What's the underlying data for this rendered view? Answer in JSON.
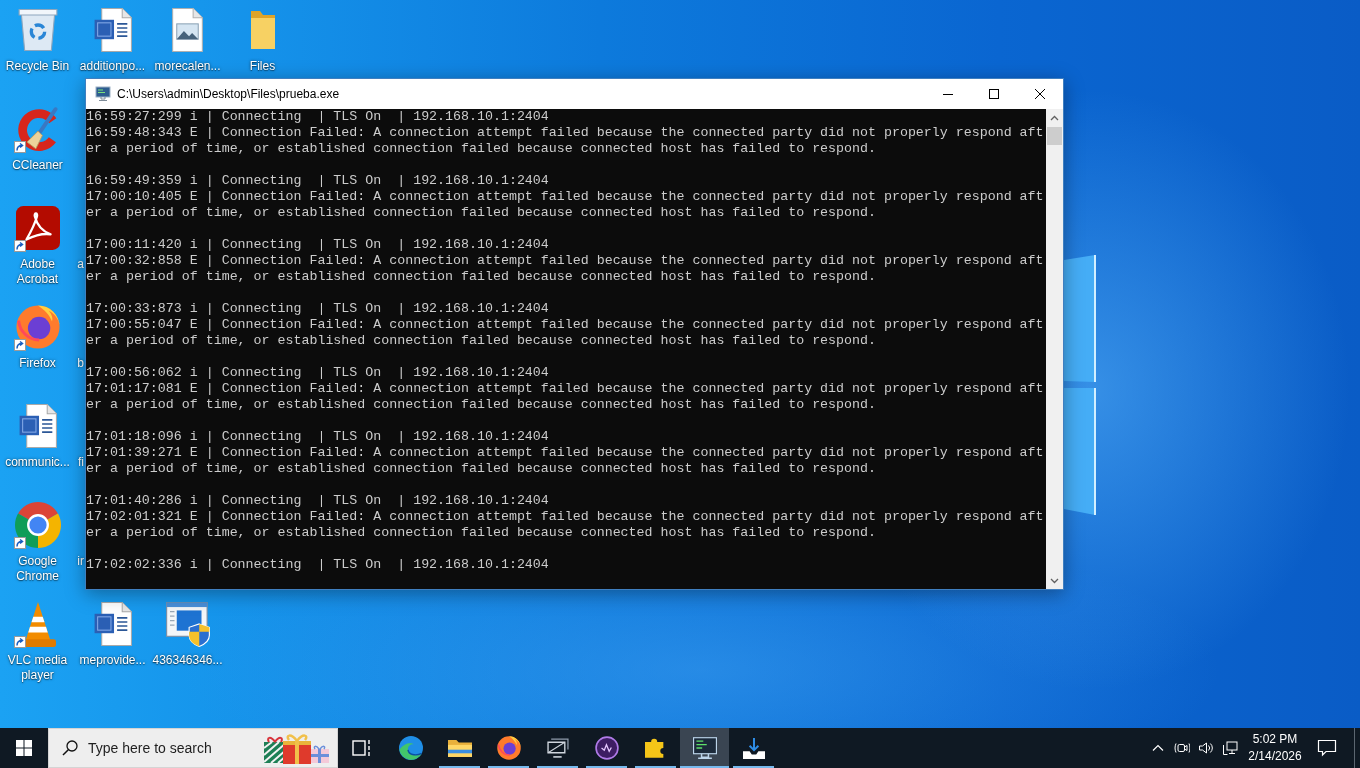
{
  "desktop": {
    "top_row": [
      {
        "label": "Recycle Bin",
        "kind": "bin",
        "shortcut": false
      },
      {
        "label": "additionpo...",
        "kind": "document",
        "shortcut": false
      },
      {
        "label": "morecalen...",
        "kind": "image",
        "shortcut": false
      },
      {
        "label": "Files",
        "kind": "folder",
        "shortcut": false
      }
    ],
    "left_column": [
      {
        "label": "CCleaner",
        "kind": "cleaner",
        "shortcut": true
      },
      {
        "label": "Adobe Acrobat",
        "kind": "pdf",
        "shortcut": true
      },
      {
        "label": "Firefox",
        "kind": "firefox",
        "shortcut": true
      },
      {
        "label": "communic...",
        "kind": "document",
        "shortcut": false
      },
      {
        "label": "Google Chrome",
        "kind": "chrome",
        "shortcut": true
      }
    ],
    "covered_labels": [
      "a",
      "b",
      "fi",
      "ir"
    ],
    "bottom_row": [
      {
        "label": "VLC media player",
        "kind": "vlc",
        "shortcut": true
      },
      {
        "label": "meprovide...",
        "kind": "document",
        "shortcut": false
      },
      {
        "label": "436346346...",
        "kind": "setup",
        "shortcut": false
      }
    ]
  },
  "window": {
    "title": "C:\\Users\\admin\\Desktop\\Files\\prueba.exe",
    "log": [
      {
        "info": "16:59:27:299 i | Connecting  | TLS On  | 192.168.10.1:2404",
        "error": "16:59:48:343 E | Connection Failed: A connection attempt failed because the connected party did not properly respond after a period of time, or established connection failed because connected host has failed to respond."
      },
      {
        "info": "16:59:49:359 i | Connecting  | TLS On  | 192.168.10.1:2404",
        "error": "17:00:10:405 E | Connection Failed: A connection attempt failed because the connected party did not properly respond after a period of time, or established connection failed because connected host has failed to respond."
      },
      {
        "info": "17:00:11:420 i | Connecting  | TLS On  | 192.168.10.1:2404",
        "error": "17:00:32:858 E | Connection Failed: A connection attempt failed because the connected party did not properly respond after a period of time, or established connection failed because connected host has failed to respond."
      },
      {
        "info": "17:00:33:873 i | Connecting  | TLS On  | 192.168.10.1:2404",
        "error": "17:00:55:047 E | Connection Failed: A connection attempt failed because the connected party did not properly respond after a period of time, or established connection failed because connected host has failed to respond."
      },
      {
        "info": "17:00:56:062 i | Connecting  | TLS On  | 192.168.10.1:2404",
        "error": "17:01:17:081 E | Connection Failed: A connection attempt failed because the connected party did not properly respond after a period of time, or established connection failed because connected host has failed to respond."
      },
      {
        "info": "17:01:18:096 i | Connecting  | TLS On  | 192.168.10.1:2404",
        "error": "17:01:39:271 E | Connection Failed: A connection attempt failed because the connected party did not properly respond after a period of time, or established connection failed because connected host has failed to respond."
      },
      {
        "info": "17:01:40:286 i | Connecting  | TLS On  | 192.168.10.1:2404",
        "error": "17:02:01:321 E | Connection Failed: A connection attempt failed because the connected party did not properly respond after a period of time, or established connection failed because connected host has failed to respond."
      },
      {
        "info": "17:02:02:336 i | Connecting  | TLS On  | 192.168.10.1:2404"
      }
    ]
  },
  "taskbar": {
    "search": {
      "placeholder": "Type here to search"
    },
    "apps": [
      {
        "kind": "edge",
        "running": false,
        "selected": false
      },
      {
        "kind": "explorer",
        "running": true,
        "selected": false
      },
      {
        "kind": "firefox",
        "running": true,
        "selected": false
      },
      {
        "kind": "monitor",
        "running": true,
        "selected": false
      },
      {
        "kind": "orb",
        "running": true,
        "selected": false
      },
      {
        "kind": "puzzle",
        "running": true,
        "selected": false
      },
      {
        "kind": "console",
        "running": true,
        "selected": true
      },
      {
        "kind": "installer",
        "running": true,
        "selected": false
      }
    ],
    "clock": {
      "time": "5:02 PM",
      "date": "2/14/2026"
    }
  }
}
